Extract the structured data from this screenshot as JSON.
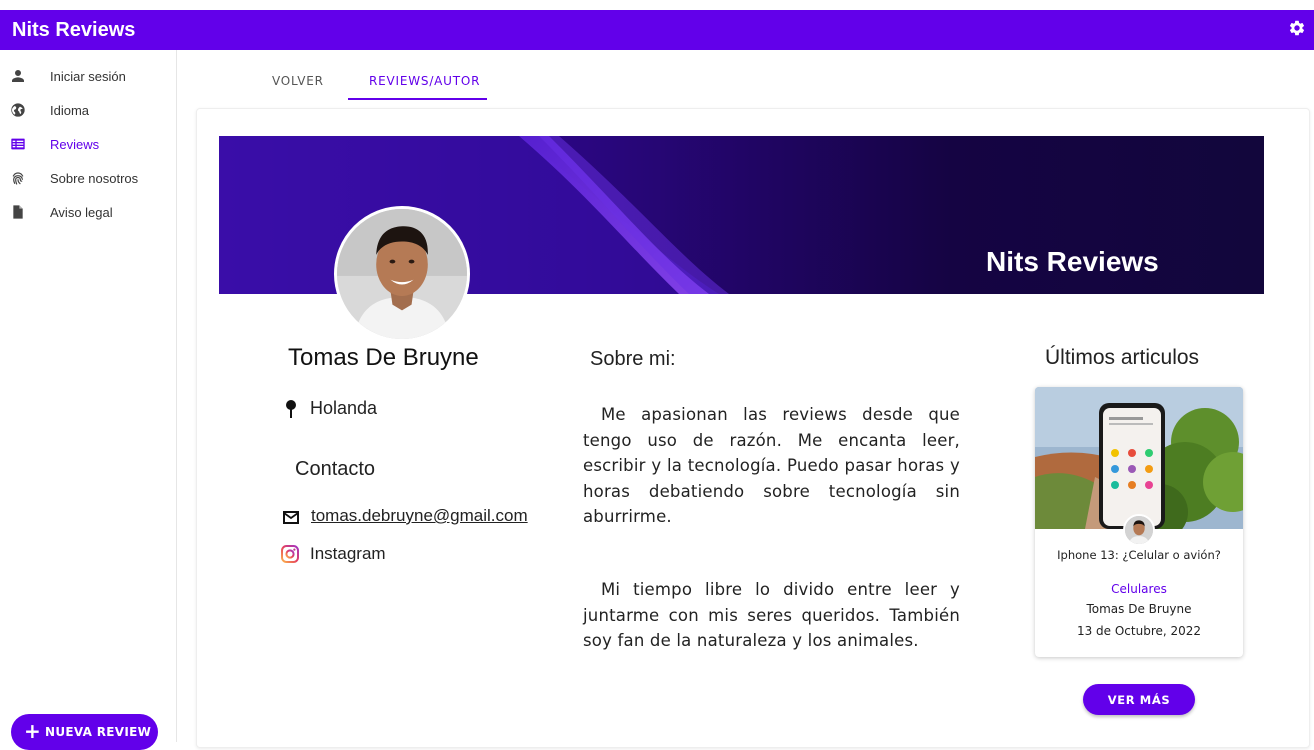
{
  "app": {
    "title": "Nits Reviews",
    "accent": "#6200ea"
  },
  "sidebar": {
    "items": [
      {
        "label": "Iniciar sesión",
        "icon": "person-icon"
      },
      {
        "label": "Idioma",
        "icon": "globe-icon"
      },
      {
        "label": "Reviews",
        "icon": "list-icon",
        "active": true
      },
      {
        "label": "Sobre nosotros",
        "icon": "fingerprint-icon"
      },
      {
        "label": "Aviso legal",
        "icon": "document-icon"
      }
    ],
    "fab_label": "NUEVA REVIEW"
  },
  "tabs": [
    {
      "label": "VOLVER"
    },
    {
      "label": "REVIEWS/AUTOR",
      "active": true
    }
  ],
  "banner": {
    "title": "Nits Reviews"
  },
  "profile": {
    "name": "Tomas De Bruyne",
    "location": "Holanda",
    "contact_heading": "Contacto",
    "email": "tomas.debruyne@gmail.com",
    "instagram": "Instagram"
  },
  "about": {
    "heading": "Sobre mi:",
    "paragraphs": [
      "Me apasionan las reviews desde que tengo uso de razón. Me encanta leer, escribir y la tecnología. Puedo pasar horas y horas debatiendo sobre tecnología sin aburrirme.",
      "Mi tiempo libre lo divido entre leer y juntarme con mis seres queridos. También soy fan de la naturaleza y los animales."
    ]
  },
  "latest": {
    "heading": "Últimos articulos",
    "articles": [
      {
        "title": "Iphone 13: ¿Celular o avión?",
        "category": "Celulares",
        "author": "Tomas De Bruyne",
        "date": "13 de Octubre, 2022"
      }
    ],
    "more_label": "VER MÁS"
  }
}
